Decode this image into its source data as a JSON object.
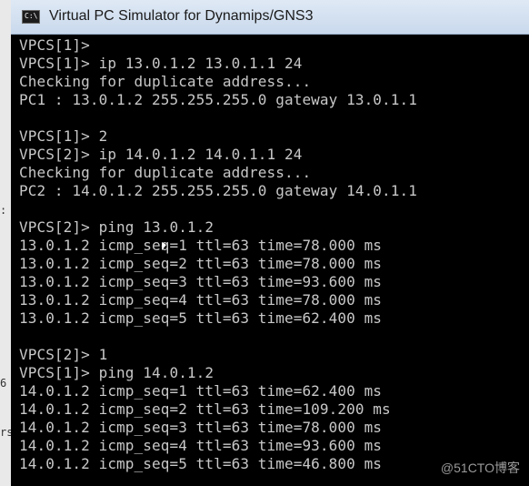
{
  "window": {
    "title": "Virtual PC Simulator for Dynamips/GNS3",
    "icon_label": "C:\\"
  },
  "background_fragments": [
    "",
    ":",
    "6",
    "rs"
  ],
  "console": {
    "lines": [
      "VPCS[1]>",
      "VPCS[1]> ip 13.0.1.2 13.0.1.1 24",
      "Checking for duplicate address...",
      "PC1 : 13.0.1.2 255.255.255.0 gateway 13.0.1.1",
      "",
      "VPCS[1]> 2",
      "VPCS[2]> ip 14.0.1.2 14.0.1.1 24",
      "Checking for duplicate address...",
      "PC2 : 14.0.1.2 255.255.255.0 gateway 14.0.1.1",
      "",
      "VPCS[2]> ping 13.0.1.2",
      "13.0.1.2 icmp_seq=1 ttl=63 time=78.000 ms",
      "13.0.1.2 icmp_seq=2 ttl=63 time=78.000 ms",
      "13.0.1.2 icmp_seq=3 ttl=63 time=93.600 ms",
      "13.0.1.2 icmp_seq=4 ttl=63 time=78.000 ms",
      "13.0.1.2 icmp_seq=5 ttl=63 time=62.400 ms",
      "",
      "VPCS[2]> 1",
      "VPCS[1]> ping 14.0.1.2",
      "14.0.1.2 icmp_seq=1 ttl=63 time=62.400 ms",
      "14.0.1.2 icmp_seq=2 ttl=63 time=109.200 ms",
      "14.0.1.2 icmp_seq=3 ttl=63 time=78.000 ms",
      "14.0.1.2 icmp_seq=4 ttl=63 time=93.600 ms",
      "14.0.1.2 icmp_seq=5 ttl=63 time=46.800 ms"
    ]
  },
  "watermark": "@51CTO博客",
  "colors": {
    "console_bg": "#000000",
    "console_fg": "#c8c8c8",
    "titlebar": "#d4e1f1"
  }
}
